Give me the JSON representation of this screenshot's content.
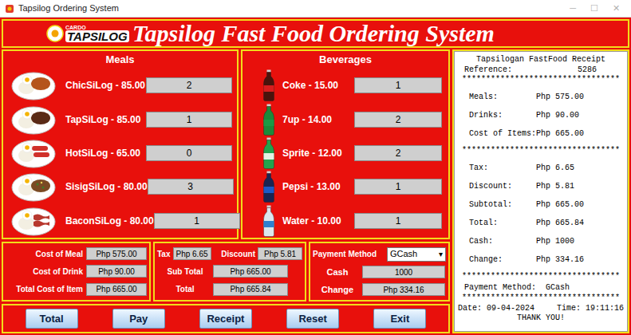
{
  "window": {
    "title": "Tapsilog Ordering System",
    "controls": [
      "─",
      "☐",
      "✕"
    ]
  },
  "header": {
    "logo_top": "CARDO",
    "logo_main": "TAPSILOG",
    "title": "Tapsilog Fast Food Ordering System"
  },
  "meals": {
    "title": "Meals",
    "items": [
      {
        "label": "ChicSiLog - 85.00",
        "quantity": "2",
        "kind": "chicken"
      },
      {
        "label": "TapSiLog - 85.00",
        "quantity": "1",
        "kind": "beef"
      },
      {
        "label": "HotSiLog - 65.00",
        "quantity": "0",
        "kind": "hotdog"
      },
      {
        "label": "SisigSiLog - 80.00",
        "quantity": "3",
        "kind": "sisig"
      },
      {
        "label": "BaconSiLog - 80.00",
        "quantity": "1",
        "kind": "bacon"
      }
    ]
  },
  "beverages": {
    "title": "Beverages",
    "items": [
      {
        "label": "Coke - 15.00",
        "quantity": "1",
        "kind": "coke"
      },
      {
        "label": "7up - 14.00",
        "quantity": "2",
        "kind": "7up"
      },
      {
        "label": "Sprite - 12.00",
        "quantity": "2",
        "kind": "sprite"
      },
      {
        "label": "Pepsi - 13.00",
        "quantity": "1",
        "kind": "pepsi"
      },
      {
        "label": "Water - 10.00",
        "quantity": "1",
        "kind": "water"
      }
    ]
  },
  "costs": [
    {
      "label": "Cost of Meal",
      "value": "Php 575.00"
    },
    {
      "label": "Cost of Drink",
      "value": "Php 90.00"
    },
    {
      "label": "Total Cost of Item",
      "value": "Php 665.00"
    }
  ],
  "charges": {
    "tax_label": "Tax",
    "tax": "Php 6.65",
    "discount_label": "Discount",
    "discount": "Php 5.81",
    "subtotal_label": "Sub Total",
    "subtotal": "Php 665.00",
    "total_label": "Total",
    "total": "Php 665.84"
  },
  "payment": {
    "method_label": "Payment Method",
    "method": "GCash",
    "dropdown_arrow": "▾",
    "cash_label": "Cash",
    "cash": "1000",
    "change_label": "Change",
    "change": "Php 334.16"
  },
  "buttons": [
    "Total",
    "Pay",
    "Receipt",
    "Reset",
    "Exit"
  ],
  "receipt": {
    "title": "Tapsilogan FastFood Receipt",
    "reference_label": "Reference:",
    "reference": "5286",
    "separator": "*********************************",
    "sections": [
      [
        {
          "label": "Meals:",
          "value": "Php 575.00"
        },
        {
          "label": "Drinks:",
          "value": "Php 90.00"
        },
        {
          "label": "Cost of Items:",
          "value": "Php 665.00"
        }
      ],
      [
        {
          "label": "Tax:",
          "value": "Php 6.65"
        },
        {
          "label": "Discount:",
          "value": "Php 5.81"
        },
        {
          "label": "Subtotal:",
          "value": "Php 665.00"
        },
        {
          "label": "Total:",
          "value": "Php 665.84"
        },
        {
          "label": "Cash:",
          "value": "Php 1000"
        },
        {
          "label": "Change:",
          "value": "Php 334.16"
        }
      ]
    ],
    "payment_label": "Payment Method:",
    "payment": "GCash",
    "date": "Date: 09-04-2024",
    "time": "Time: 19:11:16",
    "footer": "THANK YOU!"
  }
}
